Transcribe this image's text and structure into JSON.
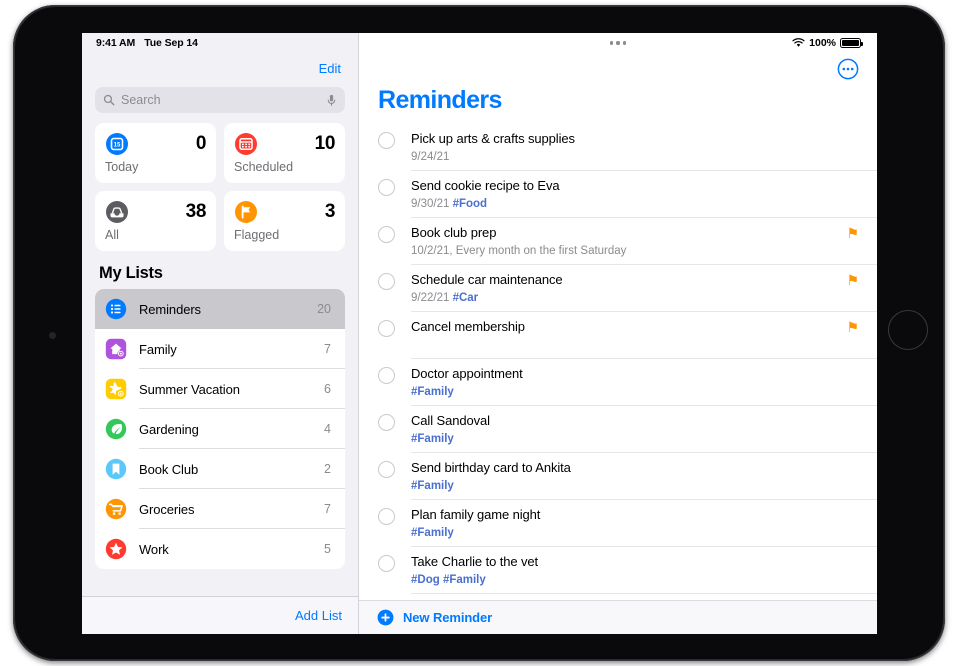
{
  "status_bar": {
    "time": "9:41 AM",
    "date": "Tue Sep 14",
    "battery_percent": "100%",
    "wifi_icon": "wifi-icon",
    "battery_icon": "battery-full-icon",
    "multitask_icon": "multitasking-dots-icon"
  },
  "sidebar": {
    "edit_label": "Edit",
    "search": {
      "placeholder": "Search",
      "value": "",
      "search_icon": "magnifying-glass-icon",
      "dictation_icon": "microphone-icon"
    },
    "smart_lists": [
      {
        "label": "Today",
        "count": "0",
        "icon": "calendar-day-icon",
        "color": "#007aff"
      },
      {
        "label": "Scheduled",
        "count": "10",
        "icon": "calendar-icon",
        "color": "#ff3b30"
      },
      {
        "label": "All",
        "count": "38",
        "icon": "inbox-tray-icon",
        "color": "#5c5c61"
      },
      {
        "label": "Flagged",
        "count": "3",
        "icon": "flag-icon",
        "color": "#ff9500"
      }
    ],
    "my_lists_header": "My Lists",
    "lists": [
      {
        "name": "Reminders",
        "count": "20",
        "icon": "bulleted-list-icon",
        "color": "#007aff",
        "shape": "circle",
        "shared": false,
        "selected": true
      },
      {
        "name": "Family",
        "count": "7",
        "icon": "house-icon",
        "color": "#af52de",
        "shape": "rounded-square",
        "shared": true,
        "selected": false
      },
      {
        "name": "Summer Vacation",
        "count": "6",
        "icon": "airplane-icon",
        "color": "#ffcc00",
        "shape": "rounded-square",
        "shared": true,
        "selected": false
      },
      {
        "name": "Gardening",
        "count": "4",
        "icon": "leaf-icon",
        "color": "#34c759",
        "shape": "circle",
        "shared": false,
        "selected": false
      },
      {
        "name": "Book Club",
        "count": "2",
        "icon": "bookmark-icon",
        "color": "#5ac8fa",
        "shape": "circle",
        "shared": false,
        "selected": false
      },
      {
        "name": "Groceries",
        "count": "7",
        "icon": "shopping-cart-icon",
        "color": "#ff9500",
        "shape": "circle",
        "shared": false,
        "selected": false
      },
      {
        "name": "Work",
        "count": "5",
        "icon": "star-icon",
        "color": "#ff3b30",
        "shape": "circle",
        "shared": false,
        "selected": false
      }
    ],
    "add_list_label": "Add List"
  },
  "main": {
    "title": "Reminders",
    "title_color": "#007aff",
    "more_button_icon": "more-circle-icon",
    "reminders": [
      {
        "title": "Pick up arts & crafts supplies",
        "date": "9/24/21",
        "tags": "",
        "flagged": false
      },
      {
        "title": "Send cookie recipe to Eva",
        "date": "9/30/21",
        "tags": "#Food",
        "flagged": false
      },
      {
        "title": "Book club prep",
        "date": "10/2/21, Every month on the first Saturday",
        "tags": "",
        "flagged": true
      },
      {
        "title": "Schedule car maintenance",
        "date": "9/22/21",
        "tags": "#Car",
        "flagged": true
      },
      {
        "title": "Cancel membership",
        "date": "",
        "tags": "",
        "flagged": true
      },
      {
        "title": "Doctor appointment",
        "date": "",
        "tags": "#Family",
        "flagged": false
      },
      {
        "title": "Call Sandoval",
        "date": "",
        "tags": "#Family",
        "flagged": false
      },
      {
        "title": "Send birthday card to Ankita",
        "date": "",
        "tags": "#Family",
        "flagged": false
      },
      {
        "title": "Plan family game night",
        "date": "",
        "tags": "#Family",
        "flagged": false
      },
      {
        "title": "Take Charlie to the vet",
        "date": "",
        "tags": "#Dog #Family",
        "flagged": false
      }
    ],
    "new_reminder_label": "New Reminder",
    "new_reminder_icon": "plus-circle-icon",
    "flag_icon": "flag-icon",
    "checkbox_icon": "empty-circle-icon"
  }
}
